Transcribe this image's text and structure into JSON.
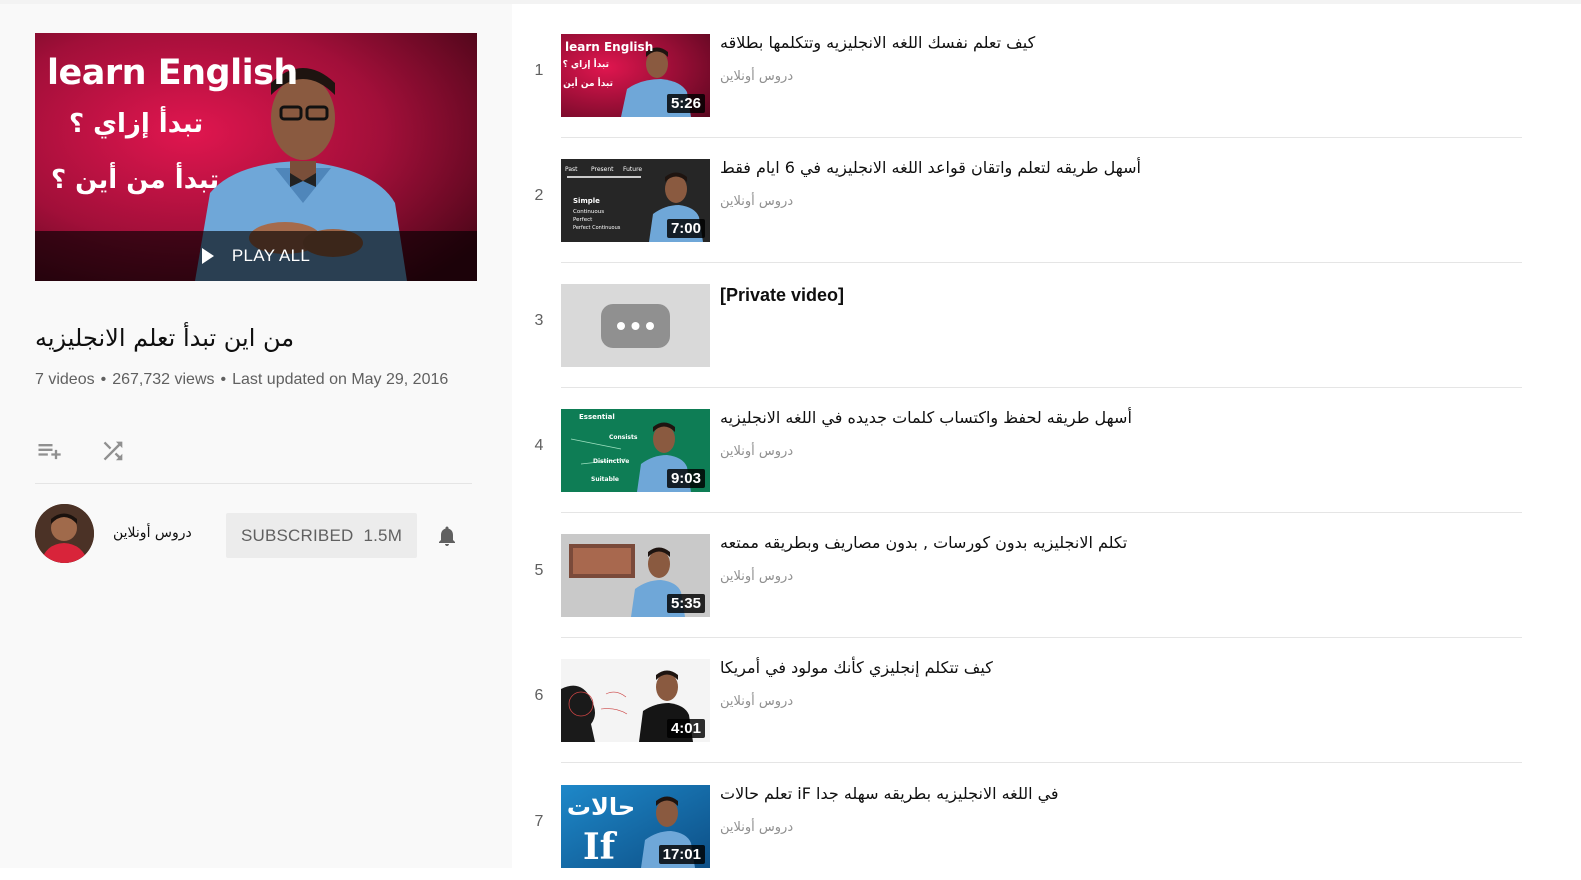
{
  "playlist": {
    "hero": {
      "line1": "learn English",
      "line2": "تبدأ إزاي ؟",
      "line3": "تبدأ من أين ؟",
      "play_all": "PLAY ALL"
    },
    "title": "من اين تبدأ تعلم الانجليزيه",
    "video_count": "7 videos",
    "views": "267,732 views",
    "updated": "Last updated on May 29, 2016",
    "owner": {
      "name": "دروس أونلاين",
      "subscribe_label": "SUBSCRIBED",
      "subscriber_count": "1.5M"
    }
  },
  "videos": [
    {
      "index": "1",
      "title": "كيف تعلم نفسك اللغه الانجليزيه وتتكلمها بطلاقه",
      "channel": "دروس أونلاين",
      "duration": "5:26",
      "thumb": "red"
    },
    {
      "index": "2",
      "title": "أسهل طريقه لتعلم واتقان قواعد اللغه الانجليزيه في 6 ايام فقط",
      "channel": "دروس أونلاين",
      "duration": "7:00",
      "thumb": "dark"
    },
    {
      "index": "3",
      "title": "[Private video]",
      "channel": "",
      "duration": "",
      "thumb": "private"
    },
    {
      "index": "4",
      "title": "أسهل طريقه لحفظ واكتساب كلمات جديده في اللغه الانجليزيه",
      "channel": "دروس أونلاين",
      "duration": "9:03",
      "thumb": "green"
    },
    {
      "index": "5",
      "title": "تكلم الانجليزيه بدون كورسات , بدون مصاريف وبطريقه ممتعه",
      "channel": "دروس أونلاين",
      "duration": "5:35",
      "thumb": "grey"
    },
    {
      "index": "6",
      "title": "كيف تتكلم إنجليزي كأنك مولود في أمريكا",
      "channel": "دروس أونلاين",
      "duration": "4:01",
      "thumb": "white"
    },
    {
      "index": "7",
      "title": "في اللغه الانجليزيه بطريقه سهله جدا iF تعلم حالات",
      "channel": "دروس أونلاين",
      "duration": "17:01",
      "thumb": "blue"
    }
  ],
  "thumb_text": {
    "t1": [
      "learn English",
      "تبدأ إزاي ؟",
      "تبدأ من أين ؟"
    ],
    "t2": [
      "Past",
      "Present",
      "Future",
      "Simple",
      "Continuous",
      "Perfect",
      "Perfect Continuous"
    ],
    "t4": [
      "Essential",
      "Consists",
      "Distinctive",
      "Suitable"
    ],
    "t7": [
      "حالات",
      "If"
    ]
  },
  "icons": {
    "save": "playlist-add-icon",
    "shuffle": "shuffle-icon",
    "bell": "bell-icon",
    "play": "play-icon"
  },
  "colors": {
    "hero_bg": "#8b0a2b",
    "private_bg": "#d9d9d9",
    "text_secondary": "#606060"
  }
}
